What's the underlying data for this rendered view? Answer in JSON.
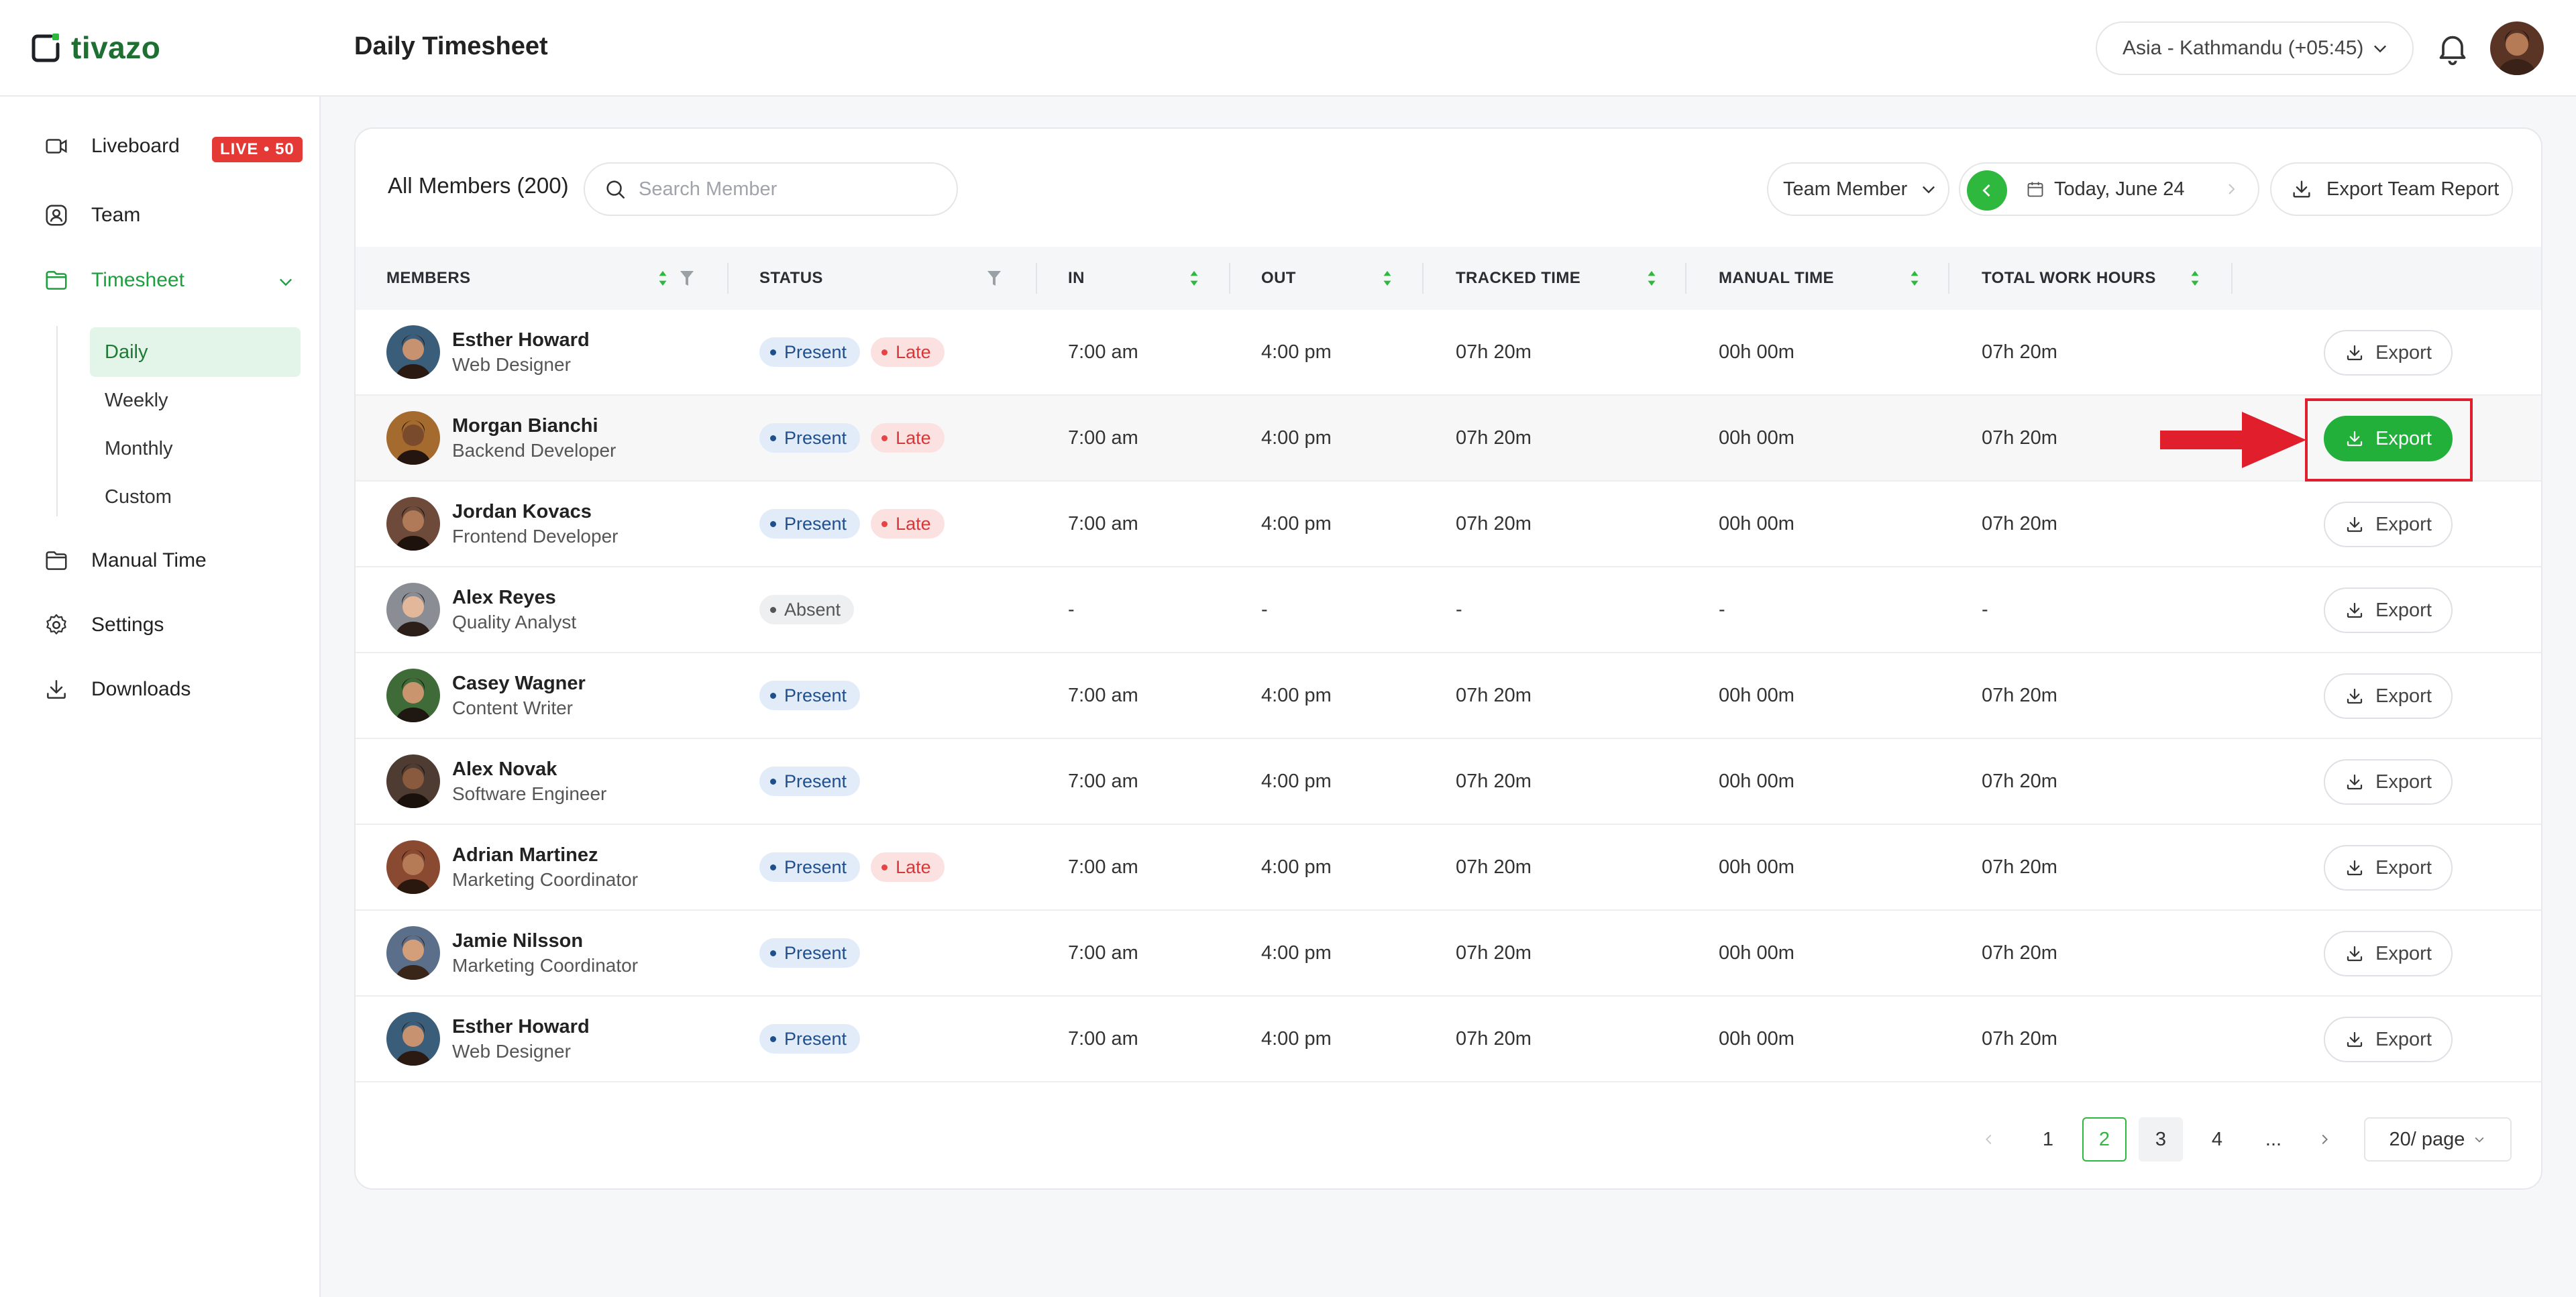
{
  "app": {
    "logo_text": "tivazo",
    "page_title": "Daily Timesheet",
    "timezone": "Asia - Kathmandu (+05:45)",
    "brand_color": "#1E9E3E",
    "accent_green": "#2EB83E"
  },
  "sidebar": {
    "items": [
      {
        "label": "Liveboard",
        "icon": "monitor-icon"
      },
      {
        "label": "Team",
        "icon": "user-icon"
      },
      {
        "label": "Timesheet",
        "icon": "folder-icon"
      },
      {
        "label": "Manual Time",
        "icon": "folder-icon"
      },
      {
        "label": "Settings",
        "icon": "gear-icon"
      },
      {
        "label": "Downloads",
        "icon": "download-icon"
      }
    ],
    "live_badge": "LIVE • 50",
    "timesheet_sub": [
      "Daily",
      "Weekly",
      "Monthly",
      "Custom"
    ]
  },
  "toolbar": {
    "all_members": "All Members (200)",
    "search_placeholder": "Search Member",
    "team_select": "Team Member",
    "date_label": "Today, June 24",
    "export_team": "Export Team Report"
  },
  "table": {
    "headers": [
      "MEMBERS",
      "STATUS",
      "IN",
      "OUT",
      "TRACKED TIME",
      "MANUAL TIME",
      "TOTAL WORK HOURS"
    ],
    "export_label": "Export",
    "status_labels": {
      "present": "Present",
      "late": "Late",
      "absent": "Absent"
    },
    "rows": [
      {
        "name": "Esther Howard",
        "role": "Web Designer",
        "present": true,
        "late": true,
        "in": "7:00 am",
        "out": "4:00 pm",
        "tracked": "07h 20m",
        "manual": "00h 00m",
        "total": "07h 20m"
      },
      {
        "name": "Morgan Bianchi",
        "role": "Backend Developer",
        "present": true,
        "late": true,
        "in": "7:00 am",
        "out": "4:00 pm",
        "tracked": "07h 20m",
        "manual": "00h 00m",
        "total": "07h 20m"
      },
      {
        "name": "Jordan Kovacs",
        "role": "Frontend Developer",
        "present": true,
        "late": true,
        "in": "7:00 am",
        "out": "4:00 pm",
        "tracked": "07h 20m",
        "manual": "00h 00m",
        "total": "07h 20m"
      },
      {
        "name": "Alex Reyes",
        "role": "Quality Analyst",
        "present": false,
        "late": false,
        "in": "-",
        "out": "-",
        "tracked": "-",
        "manual": "-",
        "total": "-"
      },
      {
        "name": "Casey Wagner",
        "role": "Content Writer",
        "present": true,
        "late": false,
        "in": "7:00 am",
        "out": "4:00 pm",
        "tracked": "07h 20m",
        "manual": "00h 00m",
        "total": "07h 20m"
      },
      {
        "name": "Alex Novak",
        "role": "Software Engineer",
        "present": true,
        "late": false,
        "in": "7:00 am",
        "out": "4:00 pm",
        "tracked": "07h 20m",
        "manual": "00h 00m",
        "total": "07h 20m"
      },
      {
        "name": "Adrian Martinez",
        "role": "Marketing Coordinator",
        "present": true,
        "late": true,
        "in": "7:00 am",
        "out": "4:00 pm",
        "tracked": "07h 20m",
        "manual": "00h 00m",
        "total": "07h 20m"
      },
      {
        "name": "Jamie Nilsson",
        "role": "Marketing Coordinator",
        "present": true,
        "late": false,
        "in": "7:00 am",
        "out": "4:00 pm",
        "tracked": "07h 20m",
        "manual": "00h 00m",
        "total": "07h 20m"
      },
      {
        "name": "Esther Howard",
        "role": "Web Designer",
        "present": true,
        "late": false,
        "in": "7:00 am",
        "out": "4:00 pm",
        "tracked": "07h 20m",
        "manual": "00h 00m",
        "total": "07h 20m"
      }
    ]
  },
  "pagination": {
    "pages": [
      "1",
      "2",
      "3",
      "4",
      "..."
    ],
    "current": "2",
    "per_page": "20/ page"
  }
}
